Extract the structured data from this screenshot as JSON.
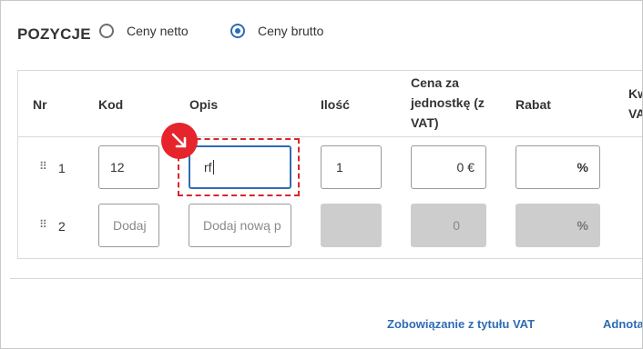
{
  "section": {
    "title": "POZYCJE"
  },
  "price_mode": {
    "options": [
      {
        "label": "Ceny netto",
        "selected": false
      },
      {
        "label": "Ceny brutto",
        "selected": true
      }
    ]
  },
  "table": {
    "headers": {
      "nr": "Nr",
      "kod": "Kod",
      "opis": "Opis",
      "ilosc": "Ilość",
      "cena_line1": "Cena za",
      "cena_line2": "jednostkę (z",
      "cena_line3": "VAT)",
      "rabat": "Rabat",
      "kwota_line1": "Kw",
      "kwota_line2": "VA"
    },
    "rows": [
      {
        "nr": "1",
        "kod": "12",
        "opis": "rf",
        "ilosc": "1",
        "cena": "0 €",
        "rabat": "%"
      },
      {
        "nr": "2",
        "kod_placeholder": "Dodaj",
        "opis_placeholder": "Dodaj nową p",
        "cena": "0",
        "rabat": "%"
      }
    ]
  },
  "footer": {
    "links": [
      "Zobowiązanie z tytułu VAT",
      "Adnota"
    ]
  },
  "colors": {
    "accent": "#2d6cb5",
    "marker": "#e5242b",
    "disabled": "#cdcdcd"
  },
  "icons": {
    "drag_handle": "drag-handle-icon",
    "marker": "arrow-down-right-icon"
  }
}
